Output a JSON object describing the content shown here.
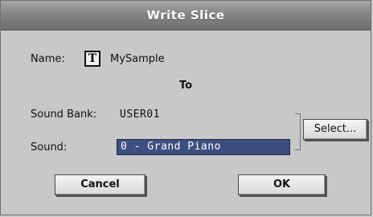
{
  "dialog": {
    "title": "Write Slice",
    "name_label": "Name:",
    "name_edit_icon": "T",
    "name_value": "MySample",
    "to_label": "To",
    "sound_bank_label": "Sound Bank:",
    "sound_bank_value": "USER01",
    "sound_label": "Sound:",
    "sound_value": "0 - Grand Piano",
    "select_label": "Select...",
    "cancel_label": "Cancel",
    "ok_label": "OK"
  },
  "colors": {
    "selected_field": "#3d4f80",
    "titlebar": "#858585",
    "background": "#c8c8c8"
  },
  "icons": {
    "name_edit": "text-edit-icon"
  }
}
